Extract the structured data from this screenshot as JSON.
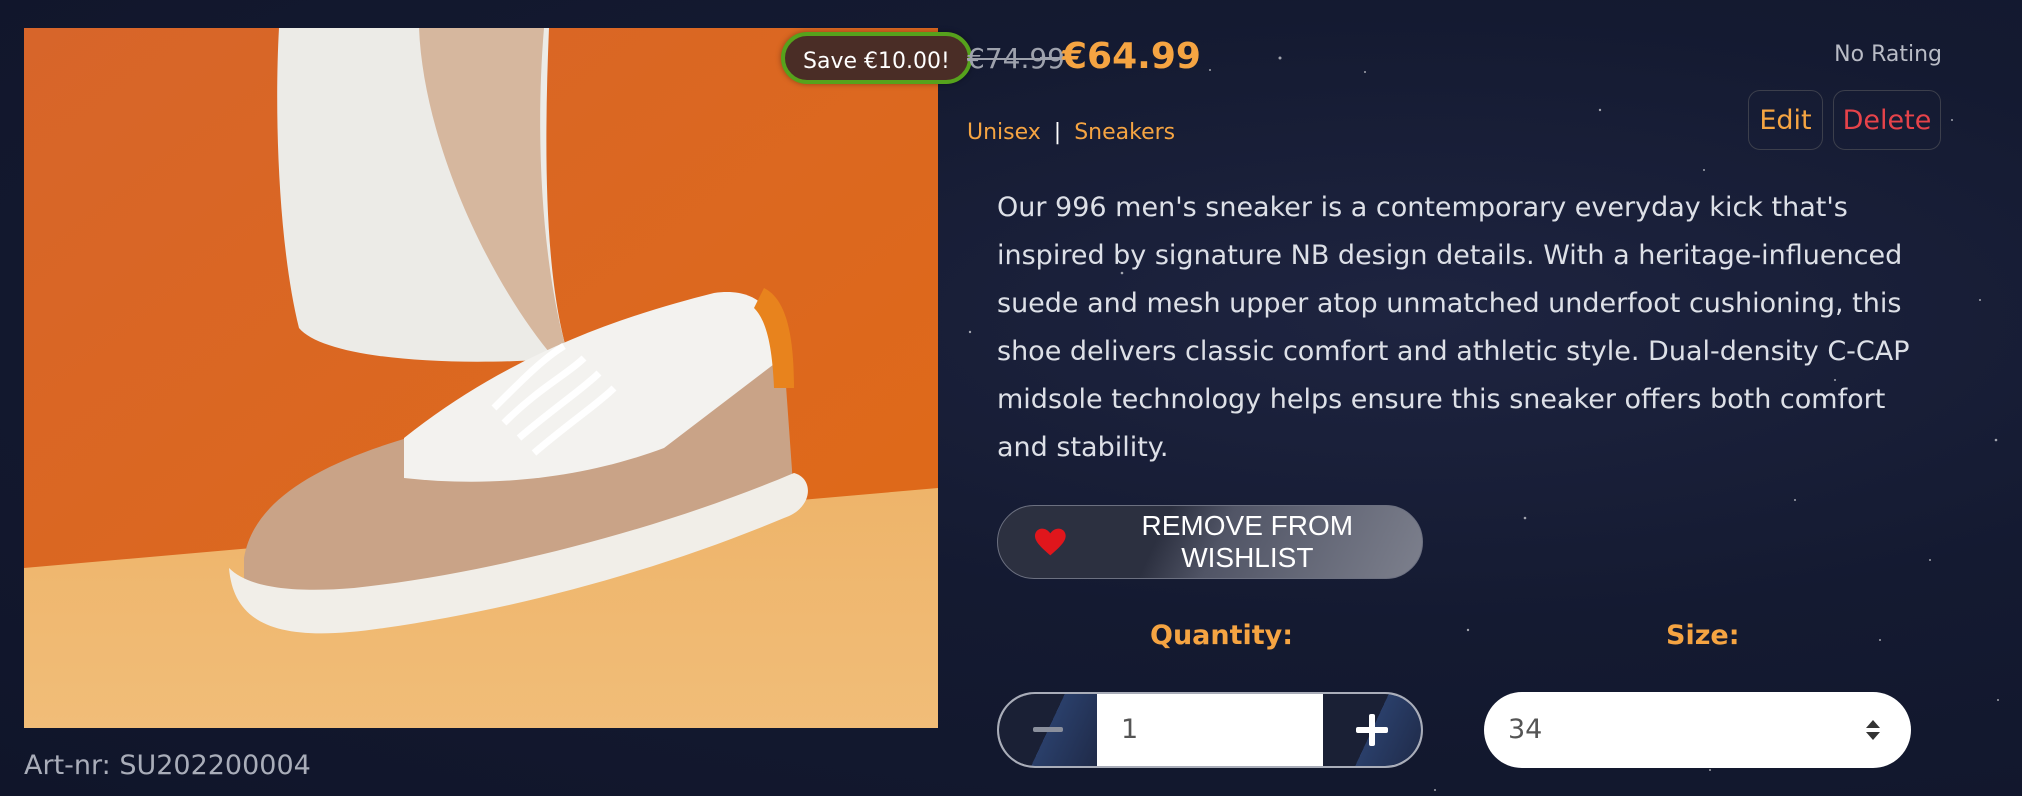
{
  "product": {
    "save_badge": "Save €10.00!",
    "old_price": "€74.99",
    "new_price": "€64.99",
    "rating": "No Rating",
    "categories": [
      "Unisex",
      "Sneakers"
    ],
    "category_separator": "|",
    "description": "Our 996 men's sneaker is a contemporary everyday kick that's inspired by signature NB design details. With a heritage-influenced suede and mesh upper atop unmatched underfoot cushioning, this shoe delivers classic comfort and athletic style. Dual-density C-CAP midsole technology helps ensure this sneaker offers both comfort and stability.",
    "art_nr": "Art-nr: SU202200004"
  },
  "actions": {
    "edit_label": "Edit",
    "delete_label": "Delete",
    "wishlist_label": "REMOVE FROM WISHLIST"
  },
  "purchase": {
    "quantity_label": "Quantity:",
    "quantity_value": "1",
    "size_label": "Size:",
    "size_value": "34"
  },
  "colors": {
    "accent": "#f5a442",
    "delete": "#e6434a",
    "badge_border": "#56a21c",
    "heart": "#e0161c"
  },
  "icons": {
    "wishlist": "heart-icon",
    "decrement": "minus-icon",
    "increment": "plus-icon",
    "size_select": "select-arrows-icon"
  }
}
